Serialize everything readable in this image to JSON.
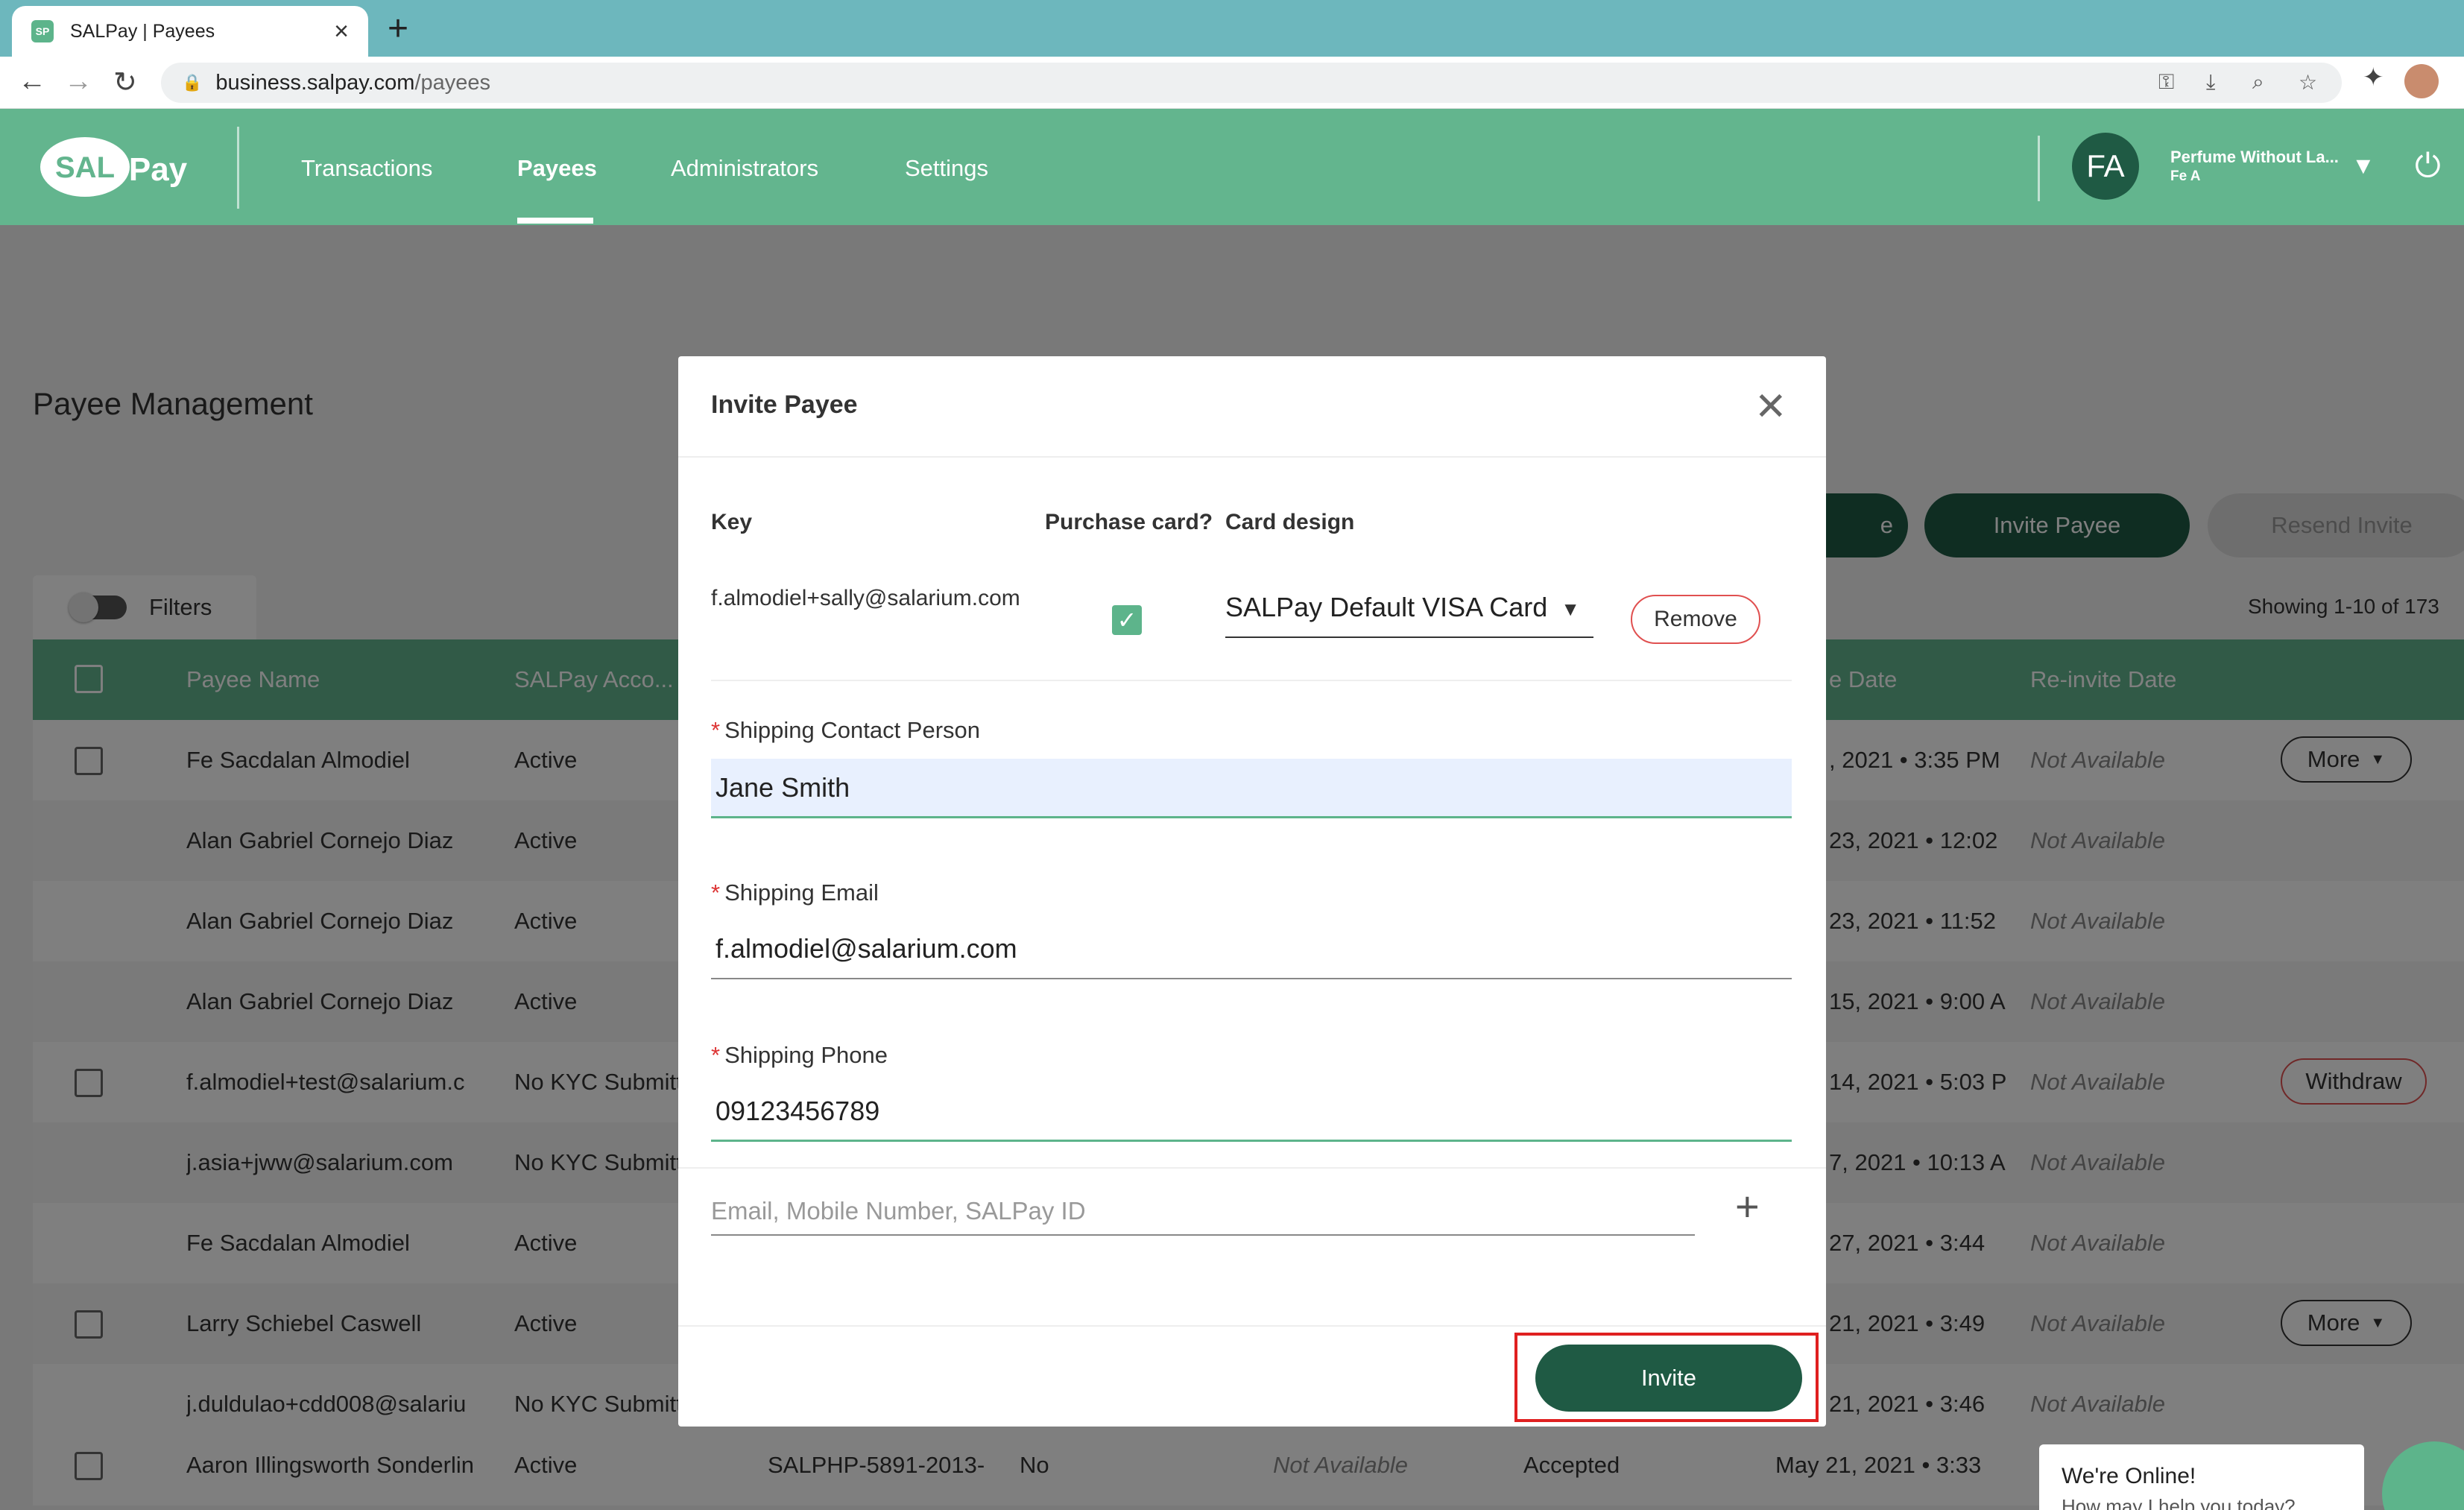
{
  "browser": {
    "tab_title": "SALPay | Payees",
    "tab_close": "×",
    "new_tab": "+",
    "url_host": "business.salpay.com",
    "url_path": "/payees"
  },
  "header": {
    "logo_sal": "SAL",
    "logo_pay": "Pay",
    "nav": [
      {
        "label": "Transactions"
      },
      {
        "label": "Payees",
        "active": true
      },
      {
        "label": "Administrators"
      },
      {
        "label": "Settings"
      }
    ],
    "avatar_initials": "FA",
    "org_name": "Perfume Without La...",
    "user_name": "Fe A"
  },
  "page": {
    "title": "Payee Management",
    "buttons": {
      "partial": "e",
      "invite_payee": "Invite Payee",
      "resend_invite": "Resend Invite"
    },
    "filters_label": "Filters",
    "showing": "Showing 1-10 of 173"
  },
  "table": {
    "headers": {
      "payee_name": "Payee Name",
      "salpay_account": "SALPay Acco...",
      "date": "e Date",
      "reinvite_date": "Re-invite Date"
    },
    "rows": [
      {
        "checkbox": true,
        "name": "Fe Sacdalan Almodiel",
        "status": "Active",
        "date": ", 2021 • 3:35 PM",
        "reinvite": "Not Available",
        "action": "More"
      },
      {
        "checkbox": false,
        "name": "Alan Gabriel Cornejo Diaz",
        "status": "Active",
        "date": "23, 2021 • 12:02",
        "reinvite": "Not Available",
        "action": ""
      },
      {
        "checkbox": false,
        "name": "Alan Gabriel Cornejo Diaz",
        "status": "Active",
        "date": "23, 2021 • 11:52",
        "reinvite": "Not Available",
        "action": ""
      },
      {
        "checkbox": false,
        "name": "Alan Gabriel Cornejo Diaz",
        "status": "Active",
        "date": "15, 2021 • 9:00 A",
        "reinvite": "Not Available",
        "action": ""
      },
      {
        "checkbox": true,
        "name": "f.almodiel+test@salarium.c",
        "status": "No KYC Submitt",
        "date": "14, 2021 • 5:03 P",
        "reinvite": "Not Available",
        "action": "Withdraw"
      },
      {
        "checkbox": false,
        "name": "j.asia+jww@salarium.com",
        "status": "No KYC Submitt",
        "date": "7, 2021 • 10:13 A",
        "reinvite": "Not Available",
        "action": ""
      },
      {
        "checkbox": false,
        "name": "Fe Sacdalan Almodiel",
        "status": "Active",
        "date": "27, 2021 • 3:44",
        "reinvite": "Not Available",
        "action": ""
      },
      {
        "checkbox": true,
        "name": "Larry Schiebel Caswell",
        "status": "Active",
        "date": "21, 2021 • 3:49",
        "reinvite": "Not Available",
        "action": "More"
      },
      {
        "checkbox": false,
        "name": "j.duldulao+cdd008@salariu",
        "status": "No KYC Submitt",
        "date": "21, 2021 • 3:46",
        "reinvite": "Not Available",
        "action": ""
      }
    ],
    "last_row": {
      "name": "Aaron Illingsworth Sonderlin",
      "status": "Active",
      "account": "SALPHP-5891-2013-",
      "purchase": "No",
      "other": "Not Available",
      "invite_status": "Accepted",
      "date": "May 21, 2021 • 3:33"
    }
  },
  "modal": {
    "title": "Invite Payee",
    "col_key": "Key",
    "col_purchase": "Purchase card?",
    "col_design": "Card design",
    "key_value": "f.almodiel+sally@salarium.com",
    "purchase_checked": true,
    "card_design": "SALPay Default VISA Card",
    "remove_label": "Remove",
    "contact_label": "Shipping Contact Person",
    "contact_value": "Jane Smith",
    "email_label": "Shipping Email",
    "email_value": "f.almodiel@salarium.com",
    "phone_label": "Shipping Phone",
    "phone_value": "09123456789",
    "add_placeholder": "Email, Mobile Number, SALPay ID",
    "invite_label": "Invite",
    "required_marker": "*"
  },
  "chat": {
    "title": "We're Online!",
    "subtitle": "How may I help you today?"
  },
  "colors": {
    "brand_green": "#63b58e",
    "dark_green": "#1f5a44",
    "highlight_red": "#e02020"
  }
}
